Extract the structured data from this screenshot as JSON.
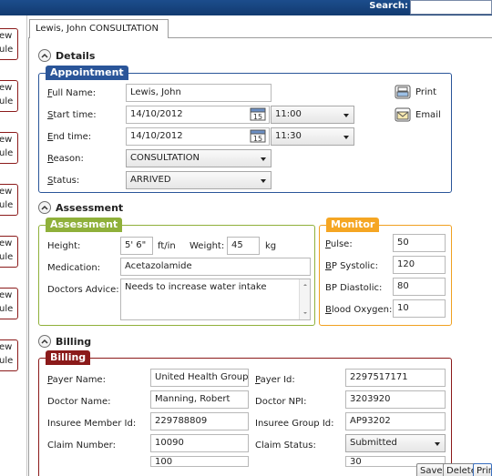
{
  "search": {
    "label": "Search:",
    "value": ""
  },
  "left_buttons": [
    {
      "line1": "ew",
      "line2": "ule"
    },
    {
      "line1": "ew",
      "line2": "ule"
    },
    {
      "line1": "ew",
      "line2": "ule"
    },
    {
      "line1": "ew",
      "line2": "ule"
    },
    {
      "line1": "ew",
      "line2": "ule"
    },
    {
      "line1": "ew",
      "line2": "ule"
    },
    {
      "line1": "ew",
      "line2": "ule"
    }
  ],
  "tab": {
    "label": "Lewis, John CONSULTATION"
  },
  "details": {
    "header": "Details",
    "group_title": "Appointment",
    "full_name_label": "Full Name:",
    "full_name_label_u": "F",
    "full_name_label_rest": "ull Name:",
    "full_name": "Lewis, John",
    "start_label_u": "S",
    "start_label_rest": "tart time:",
    "start_date": "14/10/2012",
    "start_time": "11:00",
    "end_label_u": "E",
    "end_label_rest": "nd time:",
    "end_date": "14/10/2012",
    "end_time": "11:30",
    "reason_label_u": "R",
    "reason_label_rest": "eason:",
    "reason": "CONSULTATION",
    "status_label_u": "S",
    "status_label_rest": "tatus:",
    "status": "ARRIVED",
    "calendar_day": "15",
    "print_label": "Print",
    "email_label": "Email"
  },
  "assessment": {
    "header": "Assessment",
    "group_title": "Assessment",
    "height_label": "Height:",
    "height": "5' 6\"",
    "height_unit": "ft/in",
    "weight_label": "Weight:",
    "weight": "45",
    "weight_unit": "kg",
    "medication_label": "Medication:",
    "medication": "Acetazolamide",
    "advice_label": "Doctors Advice:",
    "advice": "Needs to increase water intake"
  },
  "monitor": {
    "group_title": "Monitor",
    "pulse_label_u": "P",
    "pulse_label_rest": "ulse:",
    "pulse": "50",
    "bps_label_u": "B",
    "bps_label_rest": "P Systolic:",
    "bps": "120",
    "bpd_label": "BP Diastolic:",
    "bpd": "80",
    "bo_label_u": "B",
    "bo_label_rest": "lood Oxygen:",
    "bo": "10"
  },
  "billing": {
    "header": "Billing",
    "group_title": "Billing",
    "payer_name_label_u": "P",
    "payer_name_label_rest": "ayer Name:",
    "payer_name": "United Health Group",
    "payer_id_label_u": "P",
    "payer_id_label_rest": "ayer Id:",
    "payer_id": "2297517171",
    "doctor_name_label": "Doctor Name:",
    "doctor_name": "Manning, Robert",
    "doctor_npi_label": "Doctor NPI:",
    "doctor_npi": "3203920",
    "insuree_member_label": "Insuree Member Id:",
    "insuree_member": "229788809",
    "insuree_group_label": "Insuree Group Id:",
    "insuree_group": "AP93202",
    "claim_number_label": "Claim Number:",
    "claim_number": "10090",
    "claim_status_label": "Claim Status:",
    "claim_status": "Submitted",
    "partial_left": "100",
    "partial_right": "30"
  },
  "footer": {
    "save": "Save",
    "delete": "Delete",
    "print": "Prin"
  }
}
